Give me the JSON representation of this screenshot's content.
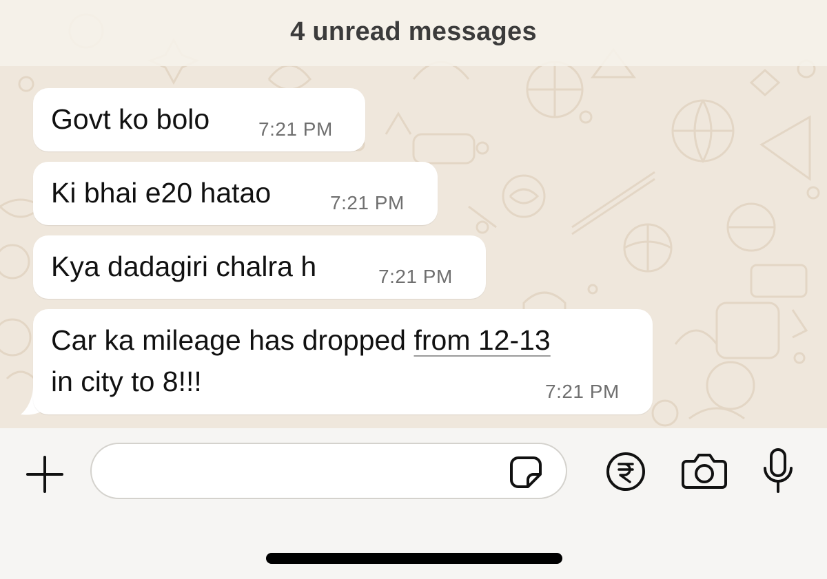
{
  "banner": {
    "unread_text": "4 unread messages"
  },
  "messages": [
    {
      "text": "Govt ko bolo",
      "time": "7:21 PM"
    },
    {
      "text": "Ki bhai e20 hatao",
      "time": "7:21 PM"
    },
    {
      "text": "Kya dadagiri chalra h",
      "time": "7:21 PM"
    },
    {
      "text_before_link": "Car ka mileage has dropped ",
      "link_text": "from 12-13",
      "text_line2": "in city to 8!!!",
      "time": "7:21 PM"
    }
  ],
  "composer": {
    "input_value": "",
    "icons": [
      "plus-icon",
      "sticker-icon",
      "rupee-payment-icon",
      "camera-icon",
      "microphone-icon"
    ]
  },
  "colors": {
    "chat_background": "#efe7dc",
    "bubble": "#ffffff",
    "composer_background": "#f6f5f3",
    "timestamp": "#6f6f6f"
  }
}
